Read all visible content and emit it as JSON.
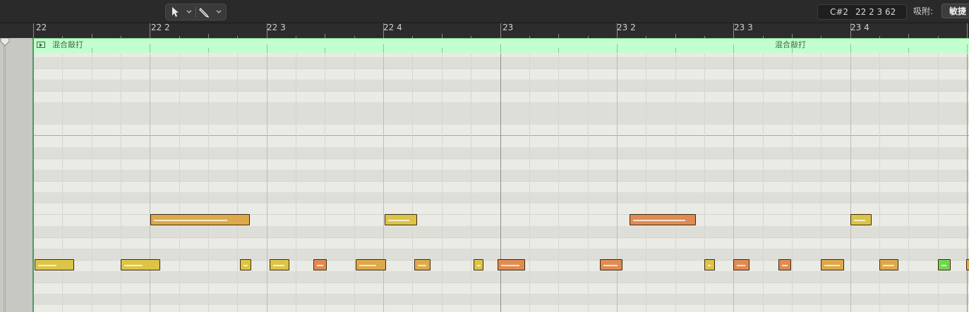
{
  "toolbar": {
    "pointer_tool": "pointer-tool-icon",
    "pencil_tool": "pencil-tool-icon",
    "readout_pitch": "C#2",
    "readout_position": "22 2 3 62",
    "snap_label": "吸附:",
    "snap_value": "敏捷"
  },
  "ruler": {
    "bars": [
      "22",
      "22 2",
      "22 3",
      "22 4",
      "23",
      "23 2",
      "23 3",
      "23 4"
    ]
  },
  "region": {
    "name_left": "混合敲打",
    "name_right": "混合敲打",
    "color": "#c3ffce"
  },
  "note_colors": {
    "yellow": "#dcc446",
    "yellow_orange": "#dda94a",
    "orange": "#e08b52",
    "green": "#6fd64d"
  }
}
